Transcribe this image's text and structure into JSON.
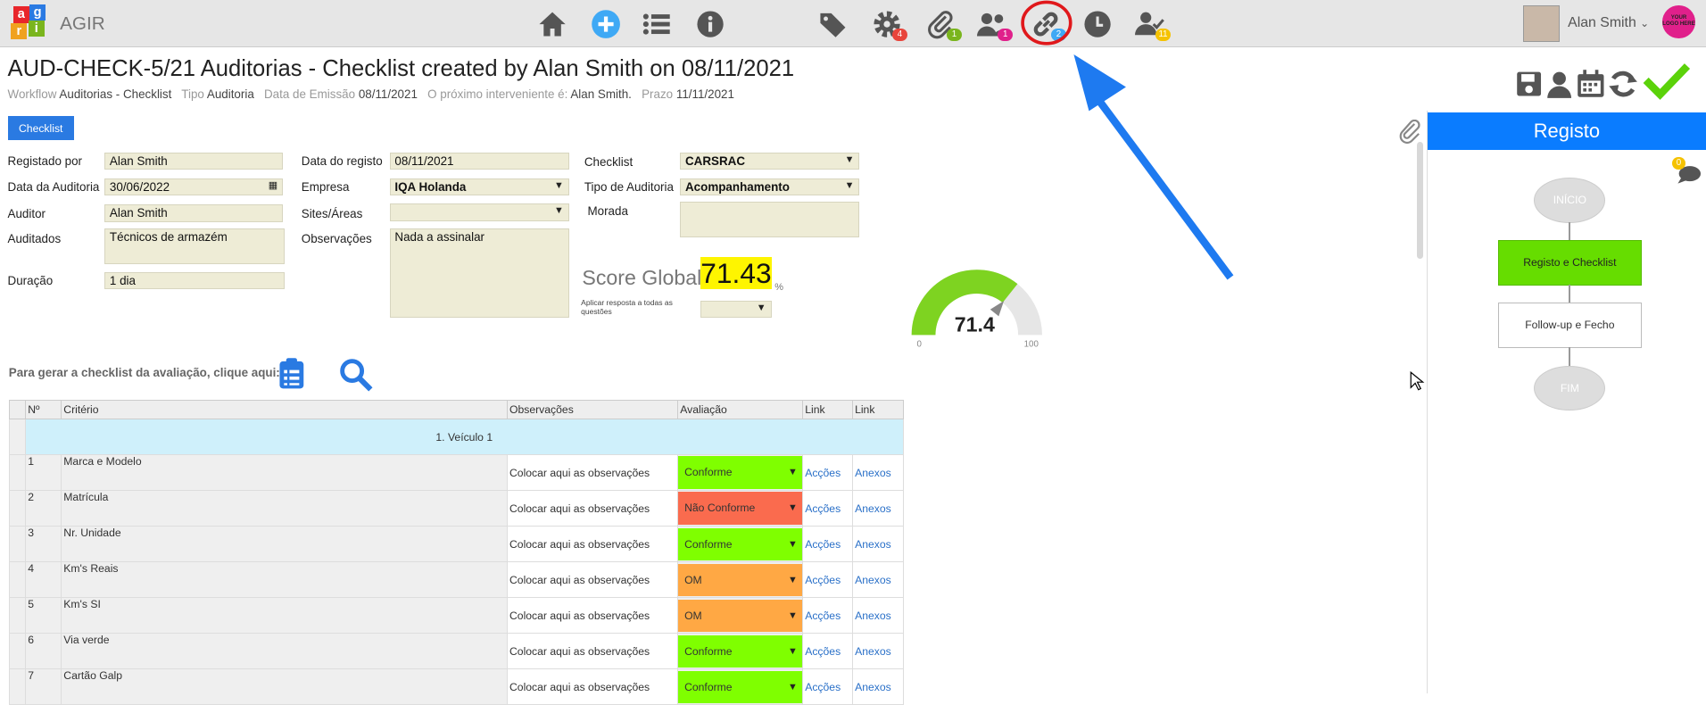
{
  "app": {
    "name": "AGIR",
    "logo_letters": [
      "a",
      "g",
      "r",
      "i"
    ]
  },
  "toolbar": {
    "icons": [
      {
        "name": "home-icon"
      },
      {
        "name": "add-icon"
      },
      {
        "name": "list-icon"
      },
      {
        "name": "info-icon"
      },
      {
        "name": "tag-icon"
      },
      {
        "name": "settings-icon",
        "badge": "4"
      },
      {
        "name": "paperclip-icon",
        "badge": "1"
      },
      {
        "name": "users-icon",
        "badge": "1"
      },
      {
        "name": "link-icon",
        "badge": "2"
      },
      {
        "name": "clock-icon"
      },
      {
        "name": "user-check-icon",
        "badge": "11"
      }
    ]
  },
  "user": {
    "name": "Alan Smith",
    "logo_text": "YOUR LOGO HERE"
  },
  "header": {
    "title": "AUD-CHECK-5/21 Auditorias - Checklist created by Alan Smith on 08/11/2021",
    "workflow_lbl": "Workflow",
    "workflow": "Auditorias - Checklist",
    "tipo_lbl": "Tipo",
    "tipo": "Auditoria",
    "emissao_lbl": "Data de Emissão",
    "emissao": "08/11/2021",
    "interveniente_lbl": "O próximo interveniente é:",
    "interveniente": "Alan Smith.",
    "prazo_lbl": "Prazo",
    "prazo": "11/11/2021"
  },
  "form": {
    "tab_button": "Checklist",
    "registado_por_lbl": "Registado por",
    "registado_por": "Alan Smith",
    "data_auditoria_lbl": "Data da Auditoria",
    "data_auditoria": "30/06/2022",
    "auditor_lbl": "Auditor",
    "auditor": "Alan Smith",
    "auditados_lbl": "Auditados",
    "auditados": "Técnicos de armazém",
    "duracao_lbl": "Duração",
    "duracao": "1 dia",
    "data_registo_lbl": "Data do registo",
    "data_registo": "08/11/2021",
    "empresa_lbl": "Empresa",
    "empresa": "IQA Holanda",
    "sites_lbl": "Sites/Áreas",
    "sites": "",
    "observacoes_lbl": "Observações",
    "observacoes": "Nada a assinalar",
    "checklist_lbl": "Checklist",
    "checklist": "CARSRAC",
    "tipo_auditoria_lbl": "Tipo de Auditoria",
    "tipo_auditoria": "Acompanhamento",
    "morada_lbl": "Morada",
    "morada": "",
    "score_lbl": "Score Global",
    "score": "71.43",
    "score_unit": "%",
    "aplicar_lbl": "Aplicar resposta a todas as questões",
    "gerar_lbl": "Para gerar a checklist da avaliação, clique aqui:"
  },
  "gauge": {
    "value": 71.4,
    "value_text": "71.4",
    "min": "0",
    "max": "100"
  },
  "workflow_panel": {
    "title": "Registo",
    "chat_badge": "0",
    "nodes": [
      "INÍCIO",
      "Registo e Checklist",
      "Follow-up e Fecho",
      "FIM"
    ]
  },
  "table": {
    "headers": [
      "Nº",
      "Critério",
      "Observações",
      "Avaliação",
      "Link",
      "Link"
    ],
    "section": "1. Veículo 1",
    "rows": [
      {
        "n": "1",
        "crit": "Marca e Modelo",
        "obs": "Colocar aqui as observações",
        "aval": "Conforme",
        "color": "#7fff00",
        "l1": "Acções",
        "l2": "Anexos"
      },
      {
        "n": "2",
        "crit": "Matrícula",
        "obs": "Colocar aqui as observações",
        "aval": "Não Conforme",
        "color": "#fa6b4e",
        "l1": "Acções",
        "l2": "Anexos"
      },
      {
        "n": "3",
        "crit": "Nr. Unidade",
        "obs": "Colocar aqui as observações",
        "aval": "Conforme",
        "color": "#7fff00",
        "l1": "Acções",
        "l2": "Anexos"
      },
      {
        "n": "4",
        "crit": "Km's Reais",
        "obs": "Colocar aqui as observações",
        "aval": "OM",
        "color": "#ffa844",
        "l1": "Acções",
        "l2": "Anexos"
      },
      {
        "n": "5",
        "crit": "Km's SI",
        "obs": "Colocar aqui as observações",
        "aval": "OM",
        "color": "#ffa844",
        "l1": "Acções",
        "l2": "Anexos"
      },
      {
        "n": "6",
        "crit": "Via verde",
        "obs": "Colocar aqui as observações",
        "aval": "Conforme",
        "color": "#7fff00",
        "l1": "Acções",
        "l2": "Anexos"
      },
      {
        "n": "7",
        "crit": "Cartão Galp",
        "obs": "Colocar aqui as observações",
        "aval": "Conforme",
        "color": "#7fff00",
        "l1": "Acções",
        "l2": "Anexos"
      }
    ]
  },
  "colors": {
    "accent": "#0a7cff",
    "field": "#eeecd6",
    "score_bg": "#fef500",
    "gauge_fill": "#7ed321",
    "highlight_circle": "#e0181b",
    "arrow": "#1e7af0"
  }
}
